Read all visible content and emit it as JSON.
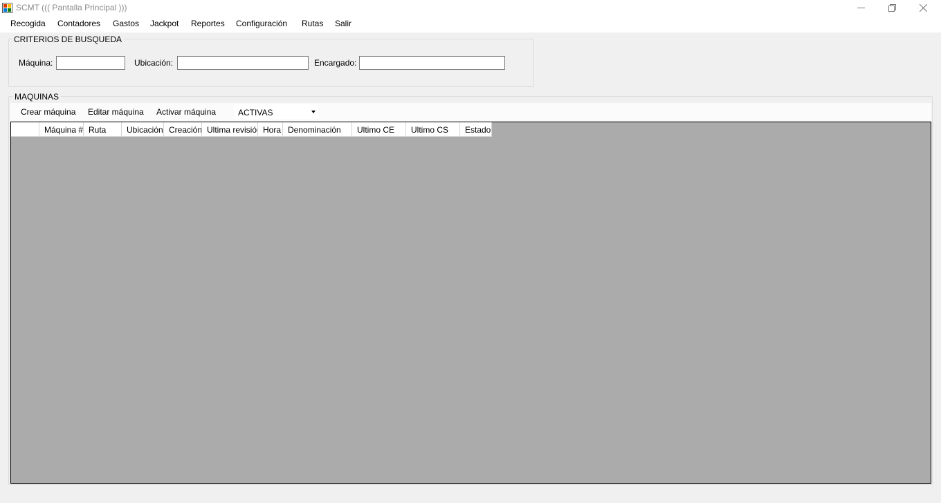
{
  "window": {
    "title": "SCMT ((( Pantalla Principal )))",
    "app_icon": "app-window-icon",
    "controls": [
      "minimize-icon",
      "restore-icon",
      "close-icon"
    ]
  },
  "menu": {
    "items": [
      "Recogida",
      "Contadores",
      "Gastos",
      "Jackpot",
      "Reportes",
      "Configuración",
      "Rutas",
      "Salir"
    ]
  },
  "search": {
    "title": "CRITERIOS DE BUSQUEDA",
    "machine_label": "Máquina:",
    "machine_value": "",
    "location_label": "Ubicación:",
    "location_value": "",
    "manager_label": "Encargado:",
    "manager_value": ""
  },
  "machines": {
    "title": "MAQUINAS",
    "create_label": "Crear máquina",
    "edit_label": "Editar máquina",
    "activate_label": "Activar máquina",
    "filter_selected": "ACTIVAS",
    "columns": [
      "",
      "Máquina #",
      "Ruta",
      "Ubicación",
      "Creación",
      "Ultima revisión",
      "Hora",
      "Denominación",
      "Ultimo CE",
      "Ultimo CS",
      "Estado"
    ],
    "rows": []
  },
  "colors": {
    "background": "#f0f0f0",
    "grid_background": "#ababab",
    "title_text": "#8a8a8a"
  }
}
